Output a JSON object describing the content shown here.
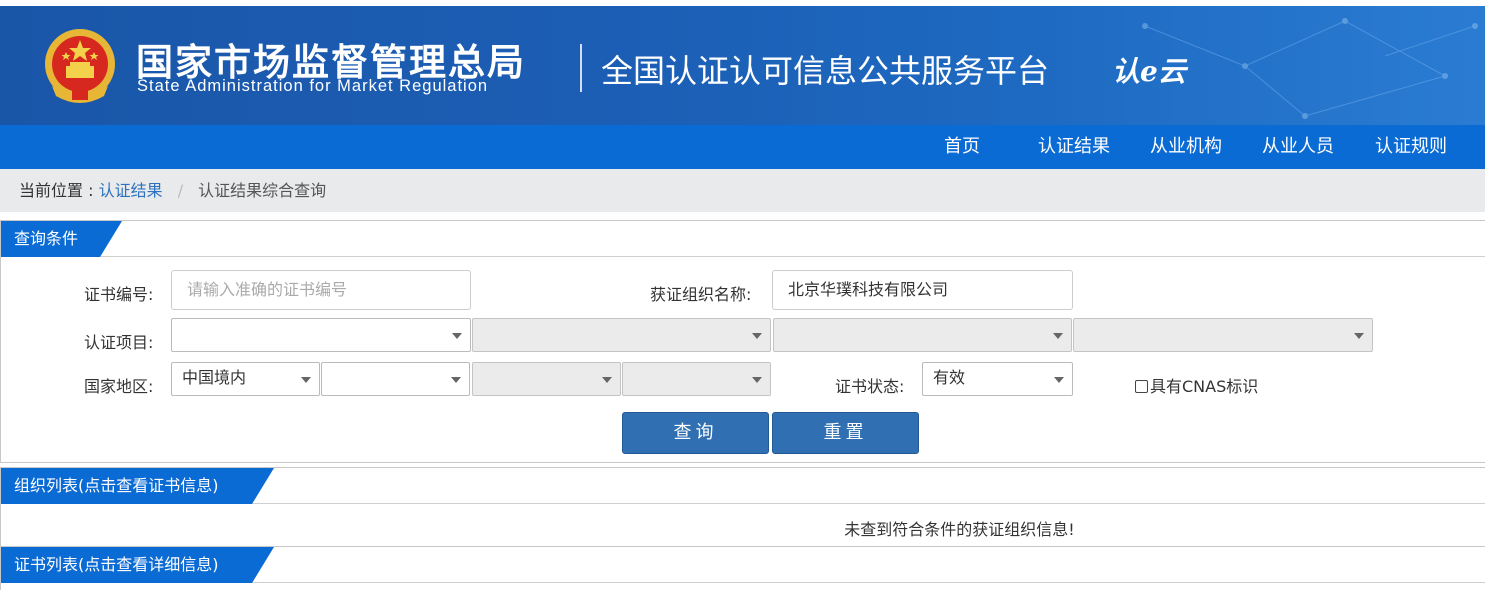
{
  "header": {
    "agency_cn": "国家市场监督管理总局",
    "agency_en": "State Administration  for  Market Regulation",
    "platform_title": "全国认证认可信息公共服务平台",
    "logo_text": "认e云"
  },
  "nav": {
    "items": [
      {
        "label": "首页"
      },
      {
        "label": "认证结果"
      },
      {
        "label": "从业机构"
      },
      {
        "label": "从业人员"
      },
      {
        "label": "认证规则"
      }
    ]
  },
  "breadcrumb": {
    "prefix": "当前位置 :",
    "link": "认证结果",
    "separator": "/",
    "current": "认证结果综合查询"
  },
  "query_panel": {
    "tab_label": "查询条件",
    "cert_no_label": "证书编号:",
    "cert_no_placeholder": "请输入准确的证书编号",
    "org_name_label": "获证组织名称:",
    "org_name_value": "北京华璞科技有限公司",
    "project_label": "认证项目:",
    "region_label": "国家地区:",
    "region_value": "中国境内",
    "status_label": "证书状态:",
    "status_value": "有效",
    "cnas_label": "具有CNAS标识",
    "search_button": "查询",
    "reset_button": "重置"
  },
  "org_panel": {
    "tab_label": "组织列表(点击查看证书信息)",
    "empty_message": "未查到符合条件的获证组织信息!"
  },
  "cert_panel": {
    "tab_label": "证书列表(点击查看详细信息)"
  },
  "colors": {
    "header_blue": "#1c5fb6",
    "nav_blue": "#0b6bd4",
    "button_blue": "#2f6fb2",
    "link_blue": "#2d72c0"
  }
}
